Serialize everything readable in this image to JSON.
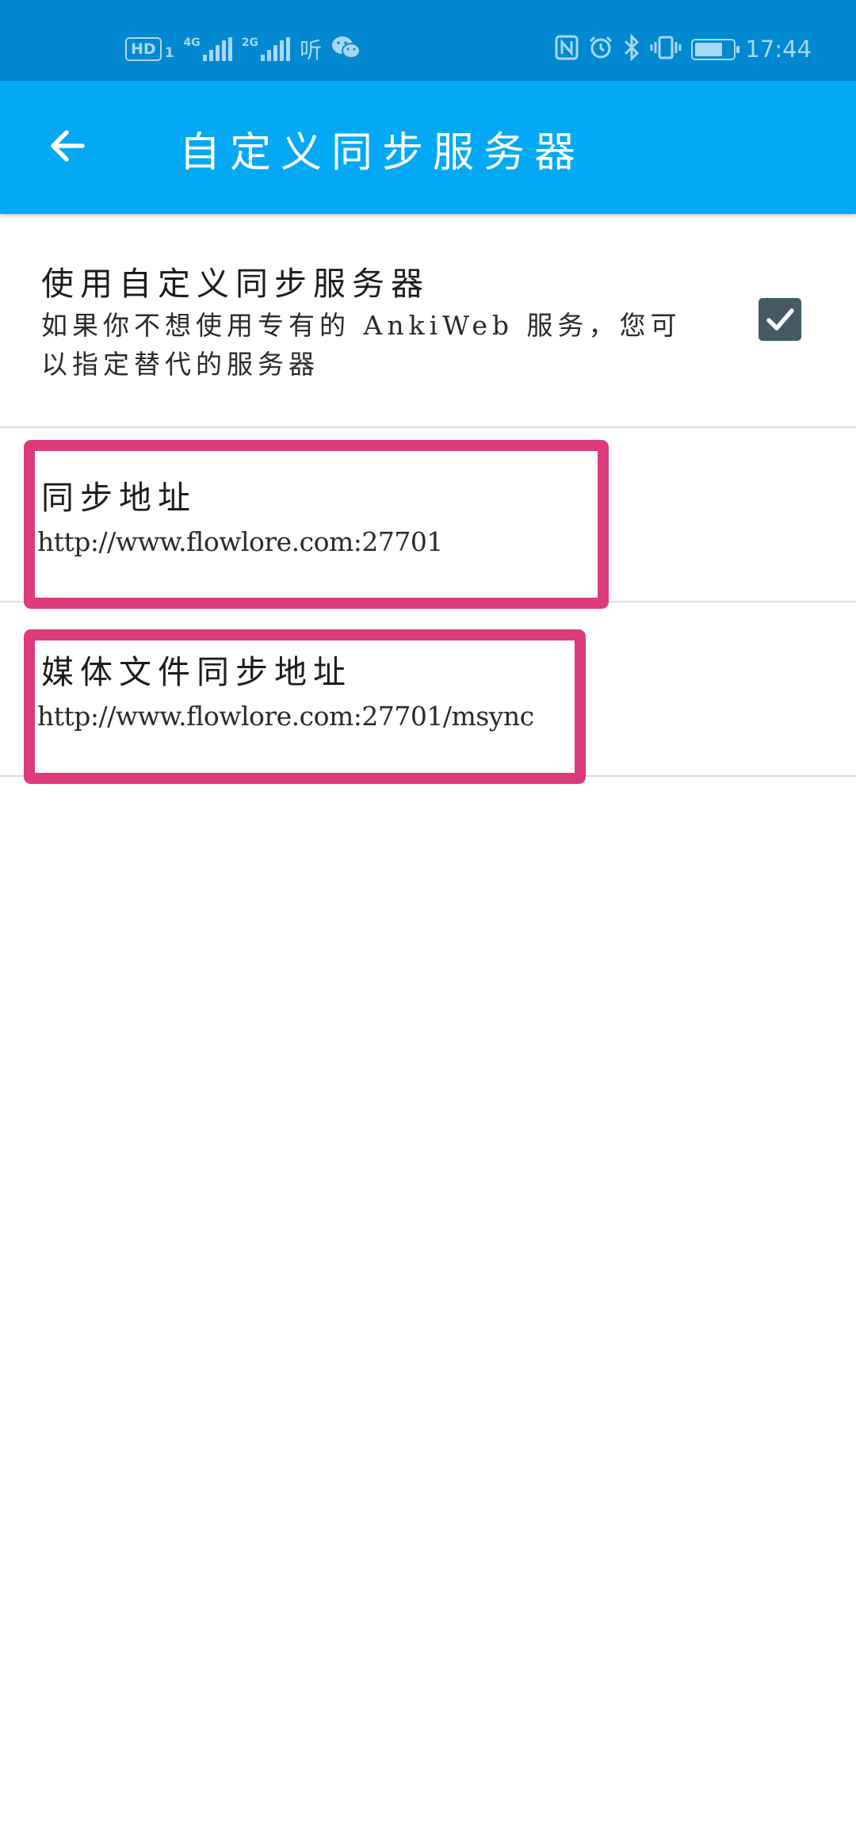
{
  "status_bar": {
    "hd_label": "HD",
    "sim_number": "1",
    "network_1": "4G",
    "network_2": "2G",
    "app_badge": "听",
    "time": "17:44",
    "icons": [
      "hd-voice-icon",
      "signal-4g-icon",
      "signal-2g-icon",
      "ting-app-icon",
      "wechat-icon",
      "nfc-icon",
      "alarm-icon",
      "bluetooth-icon",
      "vibrate-icon",
      "battery-icon"
    ]
  },
  "toolbar": {
    "title": "自定义同步服务器",
    "back_icon": "arrow-left-icon"
  },
  "preferences": {
    "use_custom": {
      "title": "使用自定义同步服务器",
      "summary": "如果你不想使用专有的 AnkiWeb 服务，您可以指定替代的服务器",
      "checked": true
    },
    "sync_url": {
      "title": "同步地址",
      "value": "http://www.flowlore.com:27701"
    },
    "media_sync_url": {
      "title": "媒体文件同步地址",
      "value": "http://www.flowlore.com:27701/msync"
    }
  },
  "colors": {
    "status_bar": "#0288d1",
    "toolbar": "#03a9f4",
    "checkbox": "#455a64",
    "highlight": "#dc3a7b"
  }
}
